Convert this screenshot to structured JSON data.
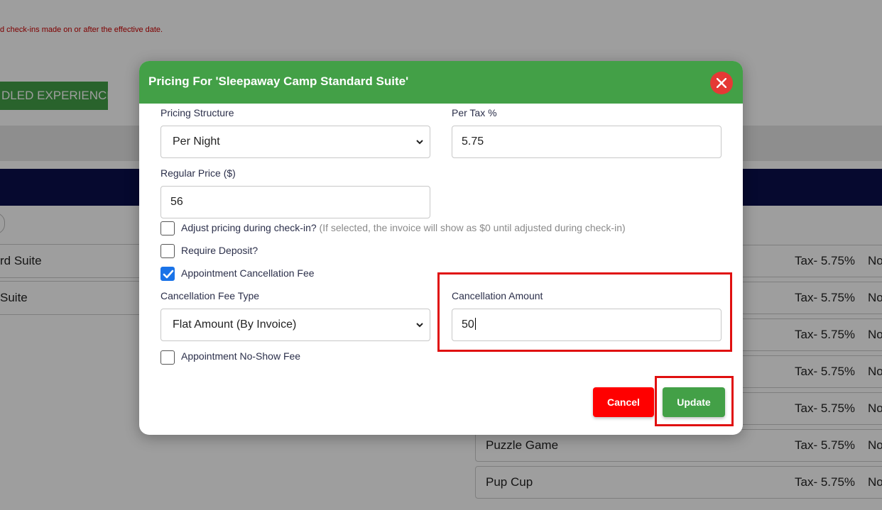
{
  "background": {
    "notice": "d check-ins made on or after the effective date.",
    "bundled_button": "DLED EXPERIENCES",
    "left_rows": [
      "rd Suite",
      "Suite"
    ],
    "right_rows": [
      {
        "name": "",
        "tax": "Tax- 5.75%",
        "extra": "No"
      },
      {
        "name": "",
        "tax": "Tax- 5.75%",
        "extra": "No"
      },
      {
        "name": "",
        "tax": "Tax- 5.75%",
        "extra": "No"
      },
      {
        "name": "",
        "tax": "Tax- 5.75%",
        "extra": "No"
      },
      {
        "name": "",
        "tax": "Tax- 5.75%",
        "extra": "No"
      },
      {
        "name": "Puzzle Game",
        "tax": "Tax- 5.75%",
        "extra": "No"
      },
      {
        "name": "Pup Cup",
        "tax": "Tax- 5.75%",
        "extra": "No"
      }
    ]
  },
  "modal": {
    "title": "Pricing For 'Sleepaway Camp Standard Suite'",
    "pricing_structure": {
      "label": "Pricing Structure",
      "value": "Per Night"
    },
    "per_tax": {
      "label": "Per Tax %",
      "value": "5.75"
    },
    "regular_price": {
      "label": "Regular Price ($)",
      "value": "56"
    },
    "adjust_pricing": {
      "label": "Adjust pricing during check-in?",
      "hint": "(If selected, the invoice will show as $0 until adjusted during check-in)",
      "checked": false
    },
    "require_deposit": {
      "label": "Require Deposit?",
      "checked": false
    },
    "appointment_cancellation_fee": {
      "label": "Appointment Cancellation Fee",
      "checked": true
    },
    "cancellation_fee_type": {
      "label": "Cancellation Fee Type",
      "value": "Flat Amount (By Invoice)"
    },
    "cancellation_amount": {
      "label": "Cancellation Amount",
      "value": "50"
    },
    "appointment_no_show_fee": {
      "label": "Appointment No-Show Fee",
      "checked": false
    },
    "cancel_label": "Cancel",
    "update_label": "Update"
  },
  "colors": {
    "header_green": "#43a047",
    "close_red": "#e53935",
    "cancel_red": "#ff0000",
    "checkbox_blue": "#1a73e8",
    "navy_bar": "#0b0f4d",
    "highlight_red": "#e01010"
  },
  "icons": {
    "close": "close-icon",
    "select_arrow": "chevron-down-icon",
    "checkbox_check": "check-icon"
  }
}
